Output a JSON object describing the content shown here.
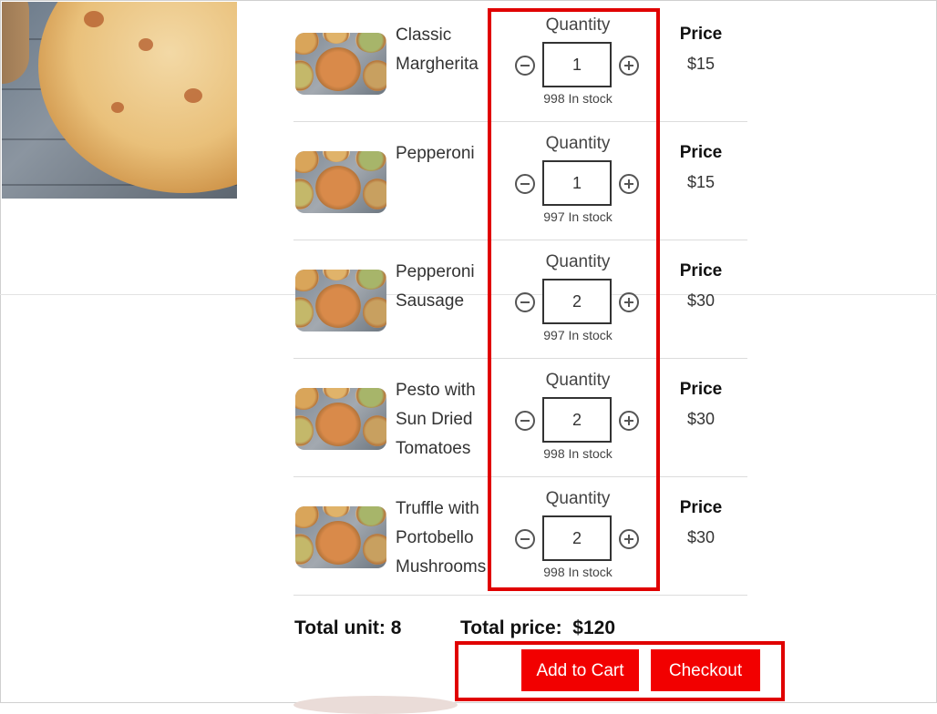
{
  "cart": {
    "items": [
      {
        "name": "Classic\nMargherita",
        "quantity_label": "Quantity",
        "quantity": "1",
        "stock": "998 In stock",
        "price_label": "Price",
        "price": "$15"
      },
      {
        "name": "Pepperoni",
        "quantity_label": "Quantity",
        "quantity": "1",
        "stock": "997 In stock",
        "price_label": "Price",
        "price": "$15"
      },
      {
        "name": "Pepperoni\nSausage",
        "quantity_label": "Quantity",
        "quantity": "2",
        "stock": "997 In stock",
        "price_label": "Price",
        "price": "$30"
      },
      {
        "name": "Pesto with\nSun Dried\nTomatoes",
        "quantity_label": "Quantity",
        "quantity": "2",
        "stock": "998 In stock",
        "price_label": "Price",
        "price": "$30"
      },
      {
        "name": "Truffle with\nPortobello\nMushrooms",
        "quantity_label": "Quantity",
        "quantity": "2",
        "stock": "998 In stock",
        "price_label": "Price",
        "price": "$30"
      }
    ],
    "total_unit": "Total unit: 8",
    "total_price": "Total price:  $120"
  },
  "actions": {
    "add_to_cart": "Add to Cart",
    "checkout": "Checkout"
  },
  "colors": {
    "accent": "#f20000",
    "highlight": "#e00000"
  },
  "icons": {
    "decrease": "minus-circle-icon",
    "increase": "plus-circle-icon"
  }
}
